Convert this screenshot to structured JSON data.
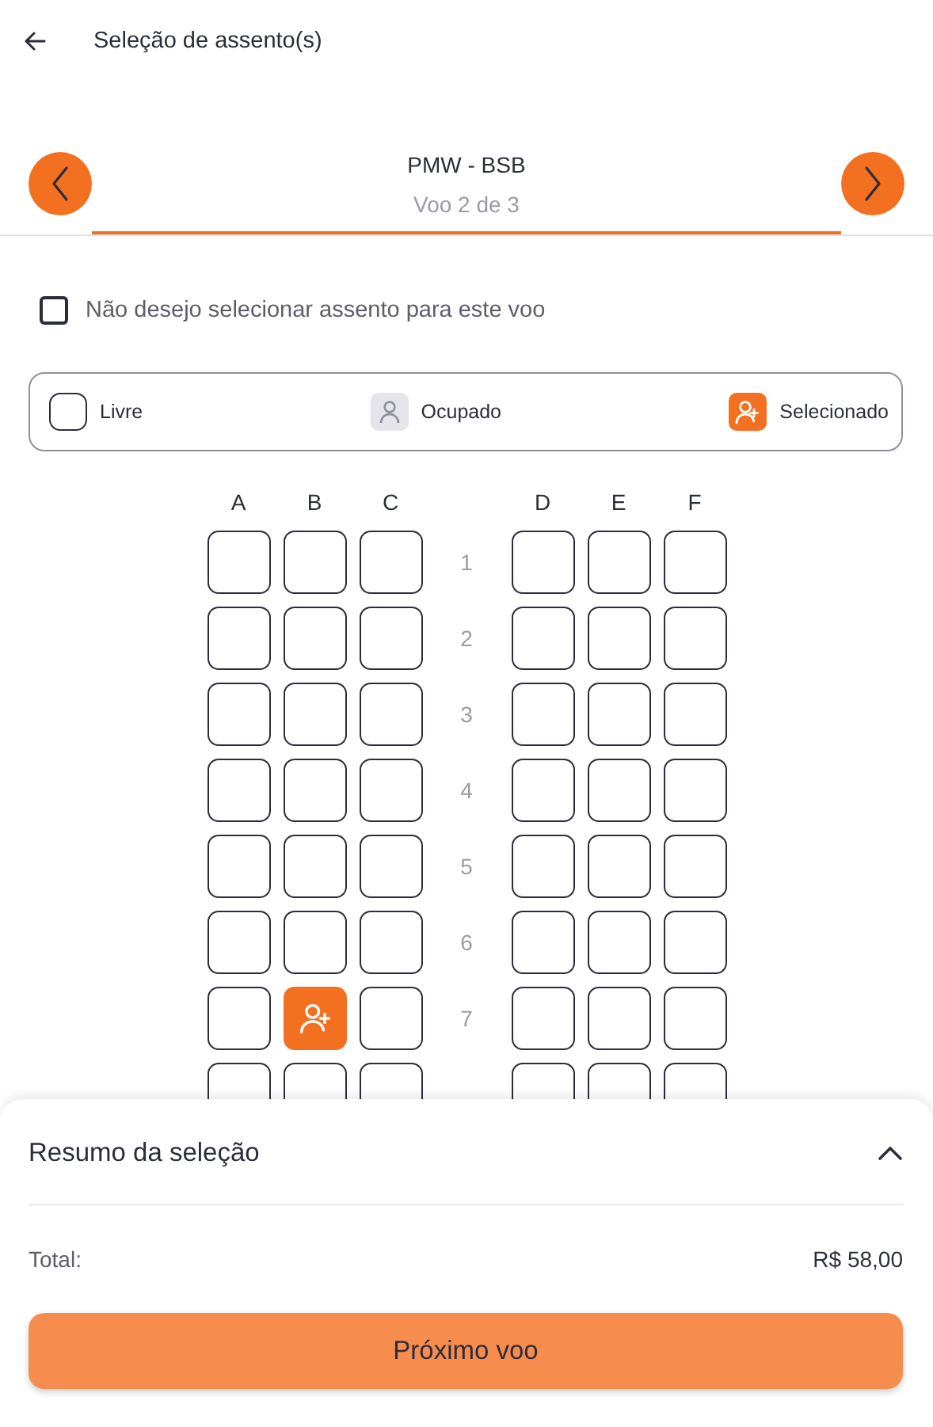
{
  "header": {
    "title": "Seleção de assento(s)"
  },
  "flight_nav": {
    "route": "PMW - BSB",
    "step": "Voo 2 de 3"
  },
  "opt_out": {
    "label": "Não desejo selecionar assento para este voo",
    "checked": false
  },
  "legend": [
    {
      "kind": "free",
      "label": "Livre"
    },
    {
      "kind": "occupied",
      "label": "Ocupado"
    },
    {
      "kind": "selected",
      "label": "Selecionado"
    }
  ],
  "seat_map": {
    "columns": [
      "A",
      "B",
      "C",
      "D",
      "E",
      "F"
    ],
    "rows": [
      {
        "number": "1",
        "seats": [
          {
            "selected": false
          },
          {
            "selected": false
          },
          {
            "selected": false
          },
          {
            "selected": false
          },
          {
            "selected": false
          },
          {
            "selected": false
          }
        ]
      },
      {
        "number": "2",
        "seats": [
          {
            "selected": false
          },
          {
            "selected": false
          },
          {
            "selected": false
          },
          {
            "selected": false
          },
          {
            "selected": false
          },
          {
            "selected": false
          }
        ]
      },
      {
        "number": "3",
        "seats": [
          {
            "selected": false
          },
          {
            "selected": false
          },
          {
            "selected": false
          },
          {
            "selected": false
          },
          {
            "selected": false
          },
          {
            "selected": false
          }
        ]
      },
      {
        "number": "4",
        "seats": [
          {
            "selected": false
          },
          {
            "selected": false
          },
          {
            "selected": false
          },
          {
            "selected": false
          },
          {
            "selected": false
          },
          {
            "selected": false
          }
        ]
      },
      {
        "number": "5",
        "seats": [
          {
            "selected": false
          },
          {
            "selected": false
          },
          {
            "selected": false
          },
          {
            "selected": false
          },
          {
            "selected": false
          },
          {
            "selected": false
          }
        ]
      },
      {
        "number": "6",
        "seats": [
          {
            "selected": false
          },
          {
            "selected": false
          },
          {
            "selected": false
          },
          {
            "selected": false
          },
          {
            "selected": false
          },
          {
            "selected": false
          }
        ]
      },
      {
        "number": "7",
        "seats": [
          {
            "selected": false
          },
          {
            "selected": true
          },
          {
            "selected": false
          },
          {
            "selected": false
          },
          {
            "selected": false
          },
          {
            "selected": false
          }
        ]
      },
      {
        "seats": [
          {
            "selected": false
          },
          {
            "selected": false
          },
          {
            "selected": false
          },
          {
            "selected": false
          },
          {
            "selected": false
          },
          {
            "selected": false
          }
        ]
      }
    ]
  },
  "summary": {
    "title": "Resumo da seleção",
    "expanded": true,
    "total_label": "Total:",
    "total_value": "R$ 58,00",
    "button": "Próximo voo"
  }
}
